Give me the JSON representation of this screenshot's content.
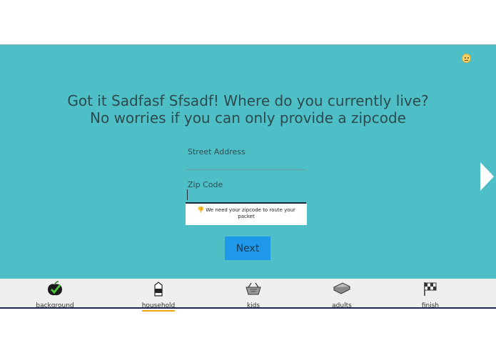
{
  "main": {
    "heading_line1": "Got it Sadfasf Sfsadf! Where do you currently live?",
    "heading_line2": "No worries if you can only provide a zipcode",
    "street_label": "Street Address",
    "street_value": "",
    "zip_label": "Zip Code",
    "zip_value": "",
    "hint_text": "We need your zipcode to route your packet",
    "next_label": "Next"
  },
  "nav": {
    "items": [
      {
        "label": "background",
        "icon": "apple-check-icon"
      },
      {
        "label": "household",
        "icon": "milk-carton-icon",
        "active": true
      },
      {
        "label": "kids",
        "icon": "basket-icon"
      },
      {
        "label": "adults",
        "icon": "sandwich-icon"
      },
      {
        "label": "finish",
        "icon": "checkered-flag-icon"
      }
    ]
  },
  "colors": {
    "background_teal": "#4fbfc7",
    "button_blue": "#1f98ea",
    "active_underline": "#f0a20f",
    "navbar_bg": "#efefef"
  }
}
